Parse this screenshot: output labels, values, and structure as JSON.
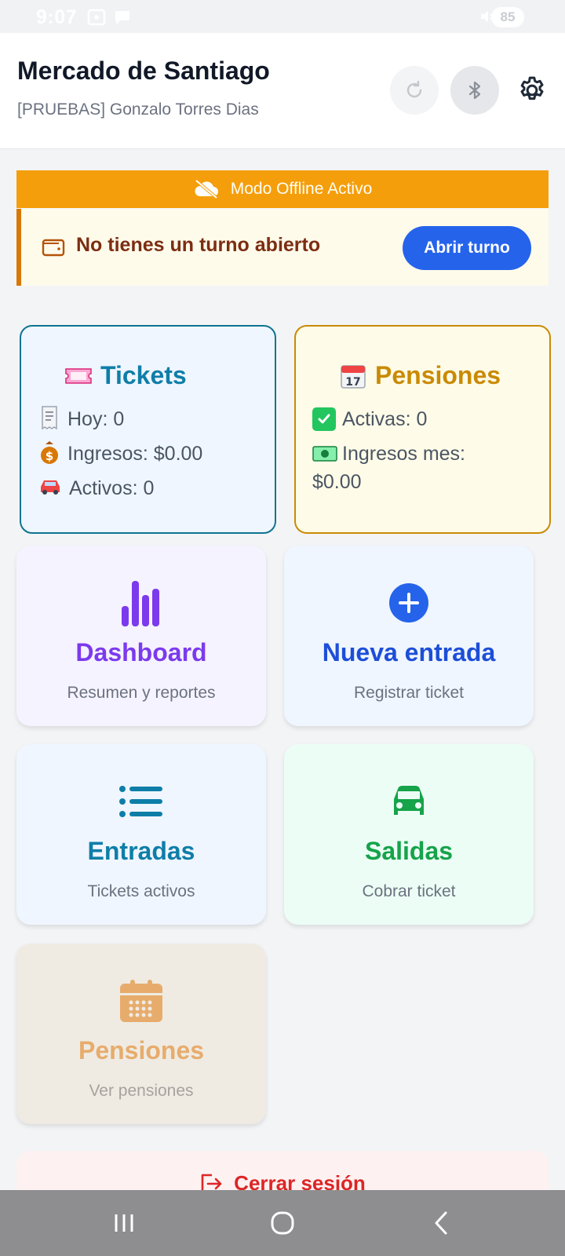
{
  "status_bar": {
    "time": "9:07",
    "battery": "85"
  },
  "header": {
    "title": "Mercado de Santiago",
    "subtitle": "[PRUEBAS] Gonzalo Torres Dias"
  },
  "offline": {
    "label": "Modo Offline Activo"
  },
  "turno": {
    "message": "No tienes un turno abierto",
    "button": "Abrir turno"
  },
  "stats": {
    "tickets": {
      "title": "Tickets",
      "hoy": "Hoy: 0",
      "ingresos": "Ingresos: $0.00",
      "activos": "Activos: 0"
    },
    "pensiones": {
      "title": "Pensiones",
      "activas": "Activas: 0",
      "ingresos_mes": "Ingresos mes:",
      "ingresos_mes_value": "$0.00",
      "calendar_day": "17"
    }
  },
  "actions": [
    {
      "title": "Dashboard",
      "subtitle": "Resumen y reportes"
    },
    {
      "title": "Nueva entrada",
      "subtitle": "Registrar ticket"
    },
    {
      "title": "Entradas",
      "subtitle": "Tickets activos"
    },
    {
      "title": "Salidas",
      "subtitle": "Cobrar ticket"
    },
    {
      "title": "Pensiones",
      "subtitle": "Ver pensiones"
    }
  ],
  "logout": {
    "label": "Cerrar sesión"
  },
  "colors": {
    "primary": "#2563eb",
    "offline": "#f59e0b",
    "danger": "#dc2626"
  }
}
